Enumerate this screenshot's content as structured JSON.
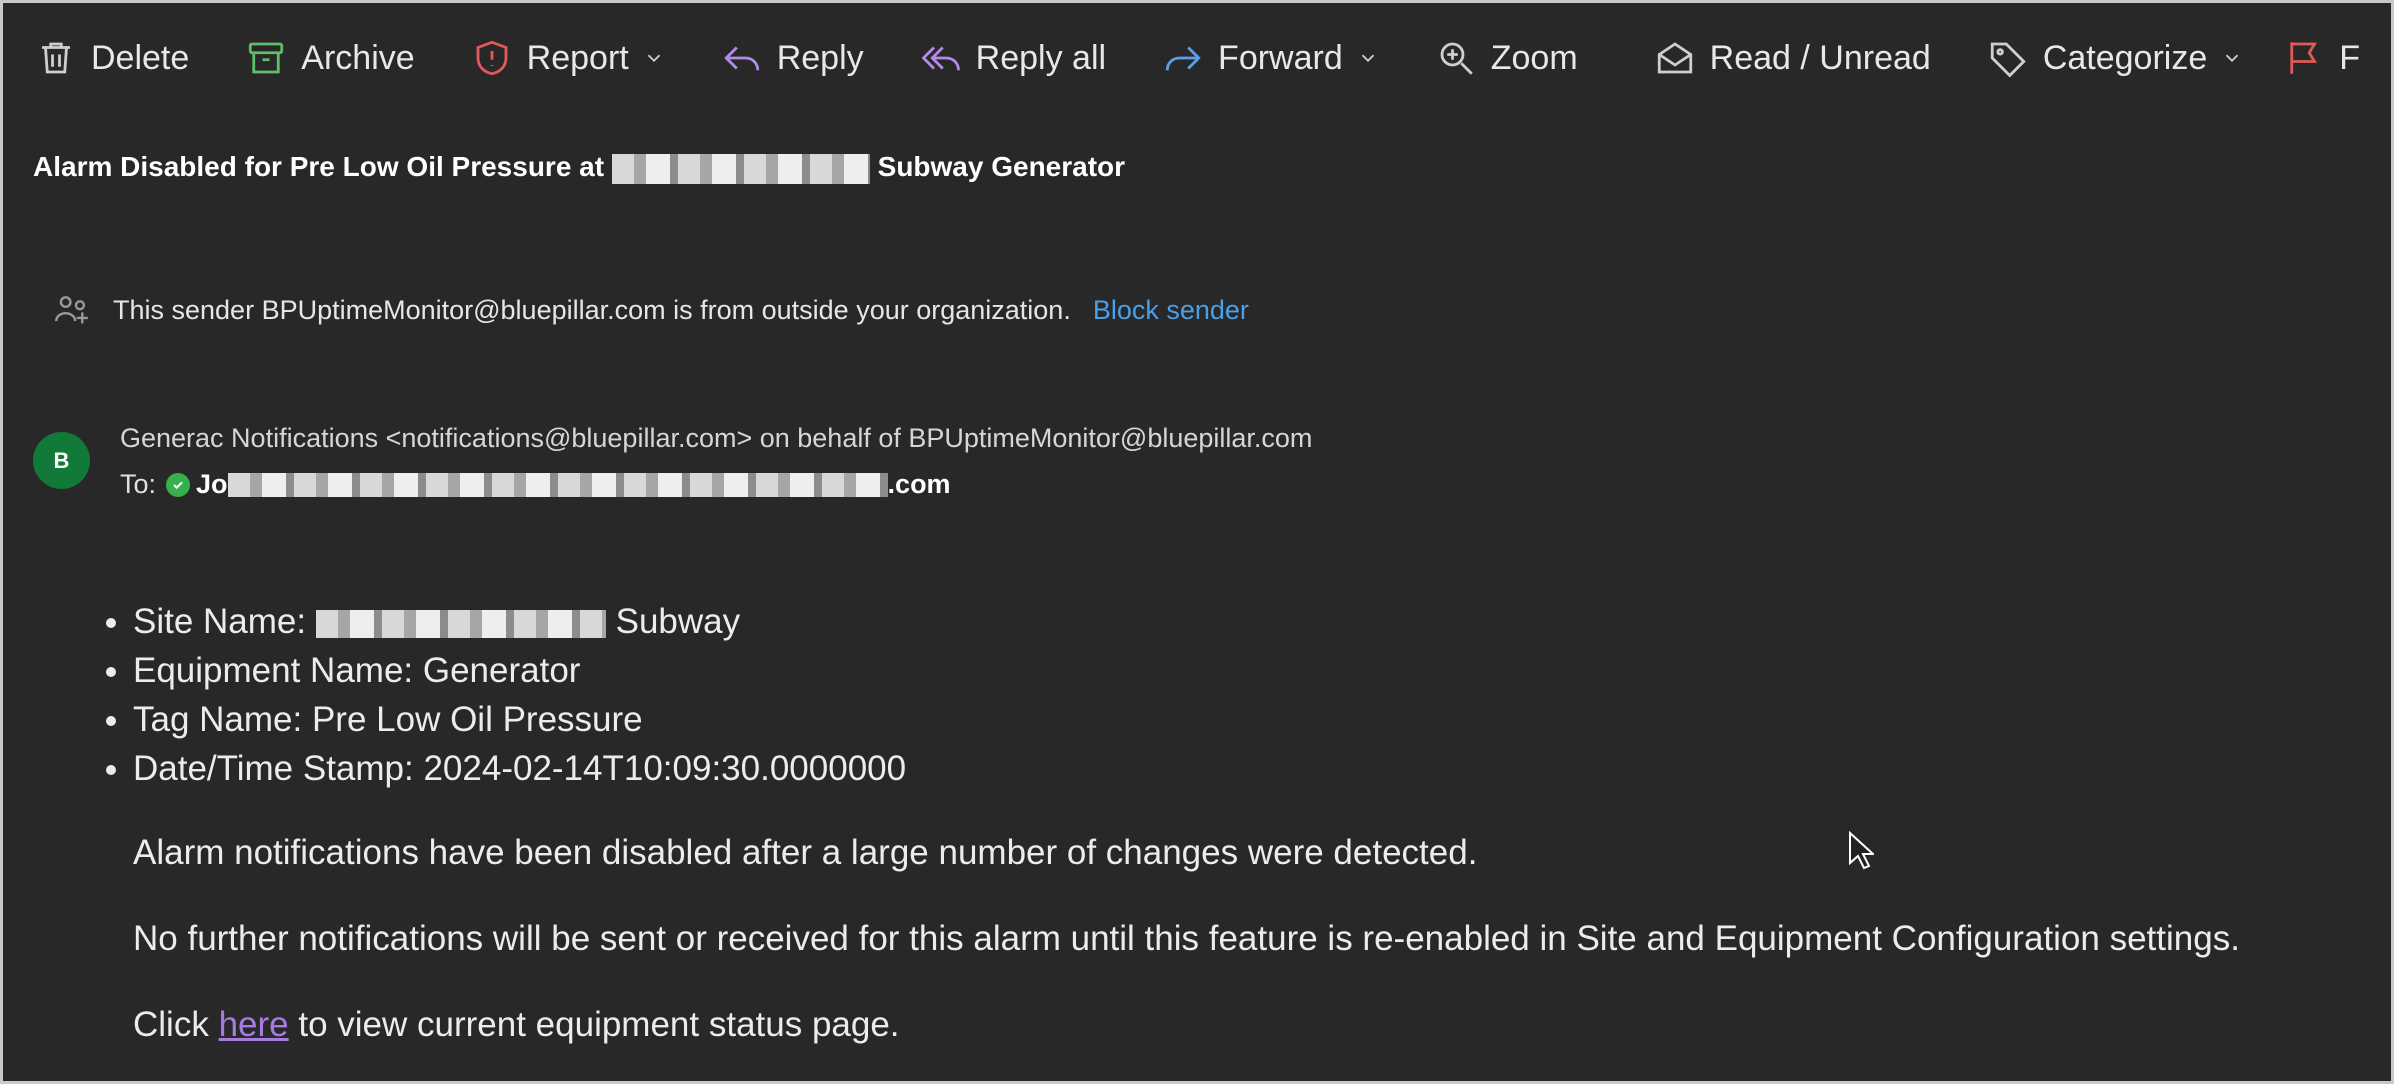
{
  "toolbar": {
    "delete": "Delete",
    "archive": "Archive",
    "report": "Report",
    "reply": "Reply",
    "reply_all": "Reply all",
    "forward": "Forward",
    "zoom": "Zoom",
    "read_unread": "Read / Unread",
    "categorize": "Categorize",
    "flag": "F"
  },
  "message": {
    "subject_prefix": "Alarm Disabled for Pre Low Oil Pressure at",
    "subject_suffix": "Subway Generator",
    "external_banner": "This sender BPUptimeMonitor@bluepillar.com is from outside your organization.",
    "block_sender": "Block sender",
    "avatar_initial": "B",
    "from_line": "Generac Notifications <notifications@bluepillar.com> on behalf of BPUptimeMonitor@bluepillar.com",
    "to_label": "To:",
    "to_start": "Jo",
    "to_end": ".com"
  },
  "body": {
    "site_name_label": "Site Name:",
    "site_name_suffix": "Subway",
    "equipment": "Equipment Name: Generator",
    "tag": "Tag Name: Pre Low Oil Pressure",
    "timestamp": "Date/Time Stamp: 2024-02-14T10:09:30.0000000",
    "para1": "Alarm notifications have been disabled after a large number of changes were detected.",
    "para2": "No further notifications will be sent or received for this alarm until this feature is re-enabled in Site and Equipment Configuration settings.",
    "para3_before": "Click",
    "para3_link": "here",
    "para3_after": "to view current equipment status page."
  },
  "colors": {
    "background": "#282828",
    "link_blue": "#4a9fe8",
    "link_visited": "#a77be3",
    "archive_green": "#5fbf6a",
    "report_red": "#e05a5a",
    "reply_purple": "#b48ae8",
    "forward_blue": "#5aa0e8",
    "avatar_green": "#127a38"
  }
}
